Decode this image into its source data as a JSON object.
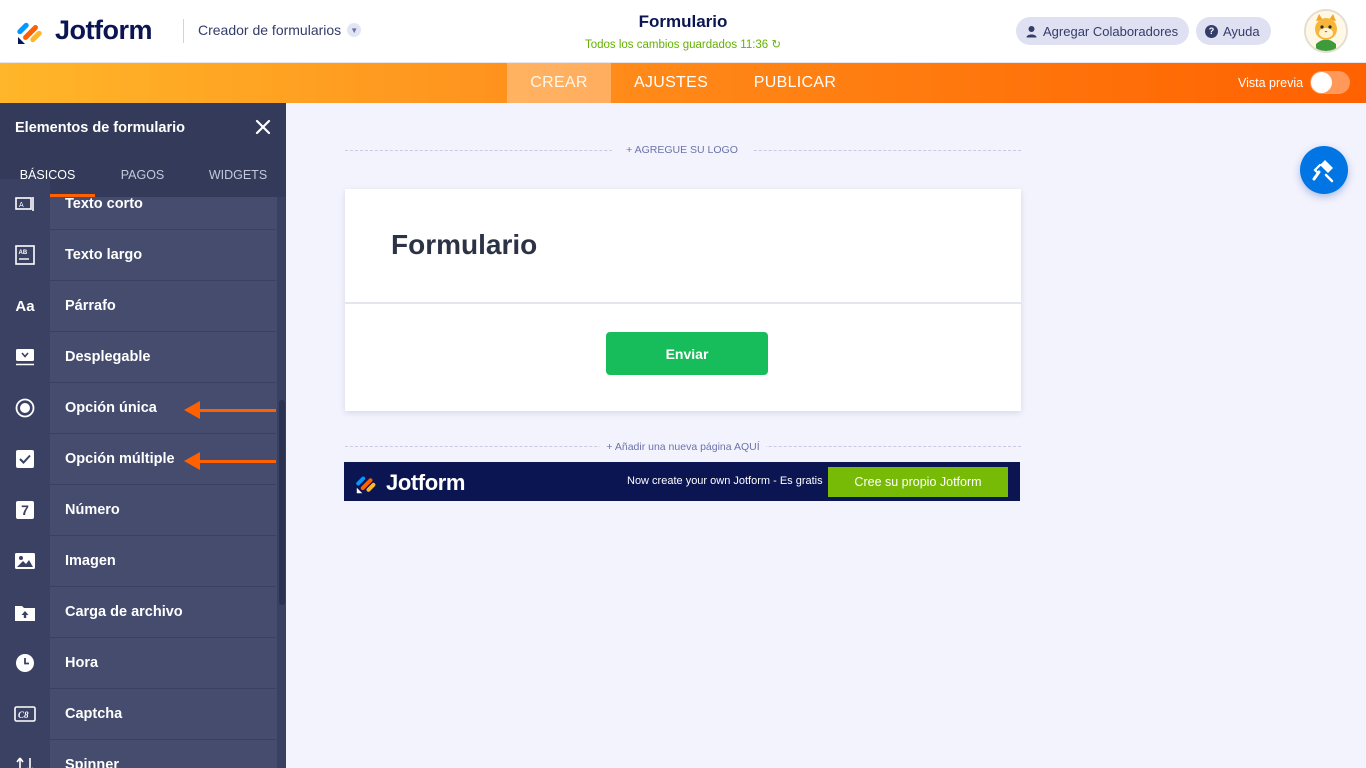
{
  "header": {
    "brand": "Jotform",
    "builder_menu": "Creador de formularios",
    "form_title": "Formulario",
    "save_status": "Todos los cambios guardados 11:36 ↻",
    "collaborators_label": "Agregar Colaboradores",
    "help_label": "Ayuda",
    "help_icon": "?"
  },
  "nav": {
    "tabs": [
      {
        "label": "CREAR",
        "active": true
      },
      {
        "label": "AJUSTES",
        "active": false
      },
      {
        "label": "PUBLICAR",
        "active": false
      }
    ],
    "preview_label": "Vista previa",
    "preview_on": false
  },
  "sidebar": {
    "title": "Elementos de formulario",
    "tabs": [
      {
        "label": "BÁSICOS",
        "active": true
      },
      {
        "label": "PAGOS",
        "active": false
      },
      {
        "label": "WIDGETS",
        "active": false
      }
    ],
    "items": [
      {
        "label": "Texto corto",
        "icon": "short-text-icon"
      },
      {
        "label": "Texto largo",
        "icon": "long-text-icon"
      },
      {
        "label": "Párrafo",
        "icon": "paragraph-icon",
        "glyph": "Aa"
      },
      {
        "label": "Desplegable",
        "icon": "dropdown-icon"
      },
      {
        "label": "Opción única",
        "icon": "radio-icon"
      },
      {
        "label": "Opción múltiple",
        "icon": "checkbox-icon"
      },
      {
        "label": "Número",
        "icon": "number-icon",
        "glyph": "7"
      },
      {
        "label": "Imagen",
        "icon": "image-icon"
      },
      {
        "label": "Carga de archivo",
        "icon": "file-upload-icon"
      },
      {
        "label": "Hora",
        "icon": "clock-icon"
      },
      {
        "label": "Captcha",
        "icon": "captcha-icon"
      },
      {
        "label": "Spinner",
        "icon": "spinner-icon"
      }
    ]
  },
  "canvas": {
    "add_logo": "+ AGREGUE SU LOGO",
    "form_heading": "Formulario",
    "submit_label": "Enviar",
    "add_page": "+ Añadir una nueva página AQUÍ",
    "banner_brand": "Jotform",
    "banner_text": "Now create your own Jotform - Es gratis",
    "banner_button": "Cree su propio Jotform"
  },
  "colors": {
    "brand_navy": "#0a1551",
    "accent_orange": "#ff6100",
    "submit_green": "#18bd5b",
    "banner_green": "#78bb07",
    "fab_blue": "#0075e3"
  }
}
